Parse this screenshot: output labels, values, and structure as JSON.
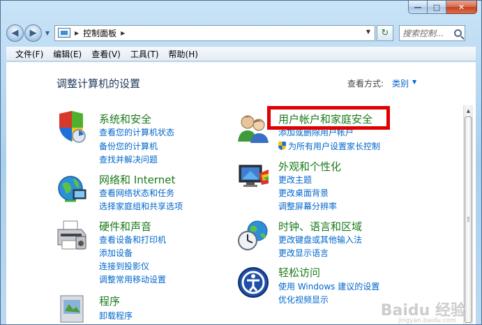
{
  "window": {
    "caption": {
      "minimize": "—",
      "maximize": "□",
      "close": "✕"
    }
  },
  "nav": {
    "back": "◀",
    "forward": "▶",
    "breadcrumb_arrow": "▶",
    "address": "控制面板",
    "address_arrow": "▶",
    "dropdown": "▼",
    "refresh": "↻",
    "search_placeholder": "搜索控制..."
  },
  "menu": [
    "文件(F)",
    "编辑(E)",
    "查看(V)",
    "工具(T)",
    "帮助(H)"
  ],
  "content": {
    "title": "调整计算机的设置",
    "view_by_label": "查看方式:",
    "view_by_value": "类别",
    "view_by_arrow": "▼",
    "left": [
      {
        "title": "系统和安全",
        "links": [
          "查看您的计算机状态",
          "备份您的计算机",
          "查找并解决问题"
        ]
      },
      {
        "title": "网络和 Internet",
        "links": [
          "查看网络状态和任务",
          "选择家庭组和共享选项"
        ]
      },
      {
        "title": "硬件和声音",
        "links": [
          "查看设备和打印机",
          "添加设备",
          "连接到投影仪",
          "调整常用移动设置"
        ]
      },
      {
        "title": "程序",
        "links": [
          "卸载程序"
        ]
      }
    ],
    "right": [
      {
        "title": "用户帐户和家庭安全",
        "links": [
          "添加或删除用户帐户",
          "为所有用户设置家长控制"
        ]
      },
      {
        "title": "外观和个性化",
        "links": [
          "更改主题",
          "更改桌面背景",
          "调整屏幕分辨率"
        ]
      },
      {
        "title": "时钟、语言和区域",
        "links": [
          "更改键盘或其他输入法",
          "更改显示语言"
        ]
      },
      {
        "title": "轻松访问",
        "links": [
          "使用 Windows 建议的设置",
          "优化视频显示"
        ]
      }
    ]
  },
  "scrollbar": {
    "up": "▲"
  },
  "watermark": {
    "main": "Baidu 经验",
    "sub": "jingyan.baidu.com"
  }
}
